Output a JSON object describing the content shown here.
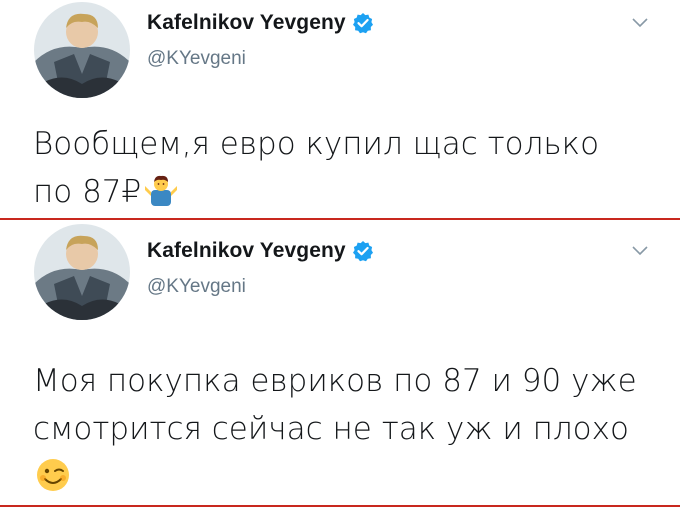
{
  "tweets": [
    {
      "display_name": "Kafelnikov Yevgeny",
      "handle": "@KYevgeni",
      "text": "Вообщем,я евро купил щас только по 87₽",
      "emoji": "person-shrugging-emoji",
      "verified_icon": "verified-badge-icon",
      "menu_icon": "chevron-down-icon"
    },
    {
      "display_name": "Kafelnikov Yevgeny",
      "handle": "@KYevgeni",
      "text": "Моя покупка евриков по 87 и 90 уже смотрится сейчас не так уж и плохо",
      "emoji": "winking-face-emoji",
      "verified_icon": "verified-badge-icon",
      "menu_icon": "chevron-down-icon"
    }
  ],
  "colors": {
    "verified": "#1da1f2",
    "handle": "#657786",
    "text": "#14171a",
    "divider": "#c8281e"
  }
}
